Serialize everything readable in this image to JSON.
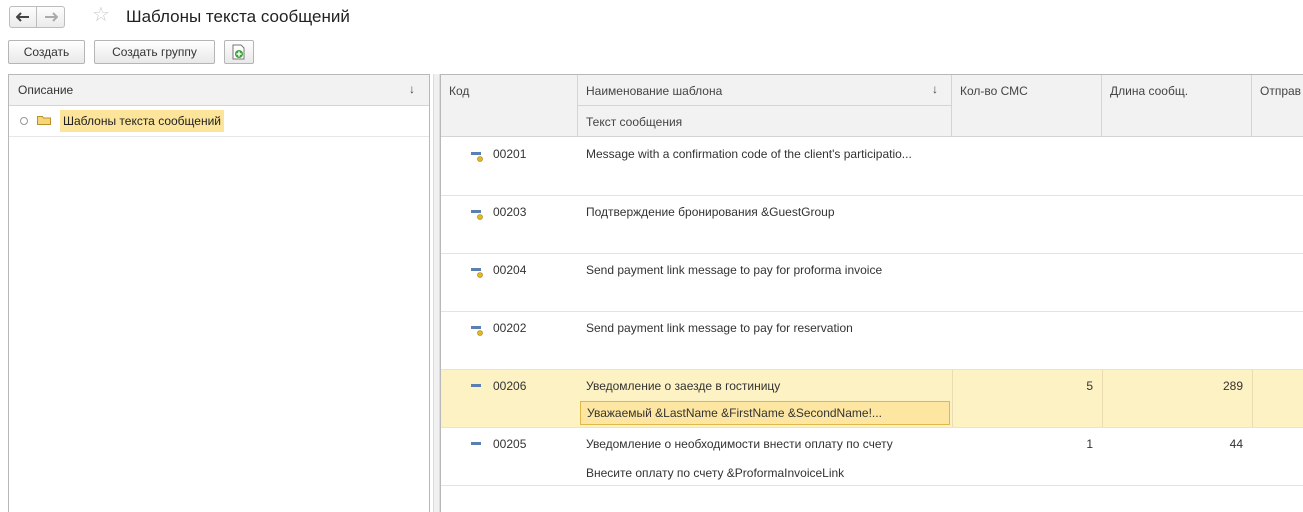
{
  "header": {
    "title": "Шаблоны текста сообщений",
    "back_icon": "arrow-left-icon",
    "forward_icon": "arrow-right-icon",
    "favorite_icon": "star-icon"
  },
  "toolbar": {
    "create_label": "Создать",
    "create_group_label": "Создать группу",
    "add_icon": "add-document-icon"
  },
  "left_panel": {
    "column_header": "Описание",
    "sort_indicator": "↓",
    "items": [
      {
        "label": "Шаблоны текста сообщений"
      }
    ]
  },
  "table": {
    "columns": {
      "code": "Код",
      "name": "Наименование шаблона",
      "name_sort": "↓",
      "text": "Текст сообщения",
      "sms_count": "Кол-во СМС",
      "length": "Длина сообщ.",
      "sent": "Отправ"
    },
    "rows": [
      {
        "code": "00201",
        "name": "Message with a confirmation code of the client's participatio...",
        "text": "",
        "sms_count": "",
        "length": ""
      },
      {
        "code": "00203",
        "name": " Подтверждение бронирования &GuestGroup",
        "text": "",
        "sms_count": "",
        "length": ""
      },
      {
        "code": "00204",
        "name": "Send payment link message to pay for proforma invoice",
        "text": "",
        "sms_count": "",
        "length": ""
      },
      {
        "code": "00202",
        "name": "Send payment link message to pay for reservation",
        "text": "",
        "sms_count": "",
        "length": ""
      },
      {
        "code": "00206",
        "name": "Уведомление о заезде в гостиницу",
        "text": "Уважаемый  &LastName &FirstName &SecondName!...",
        "sms_count": "5",
        "length": "289"
      },
      {
        "code": "00205",
        "name": "Уведомление о необходимости внести оплату по счету",
        "text": "Внесите оплату по счету &ProformaInvoiceLink",
        "sms_count": "1",
        "length": "44"
      }
    ]
  },
  "colors": {
    "selection": "#fdf2c3",
    "highlight": "#fce59a",
    "header_bg": "#f2f2f2"
  }
}
